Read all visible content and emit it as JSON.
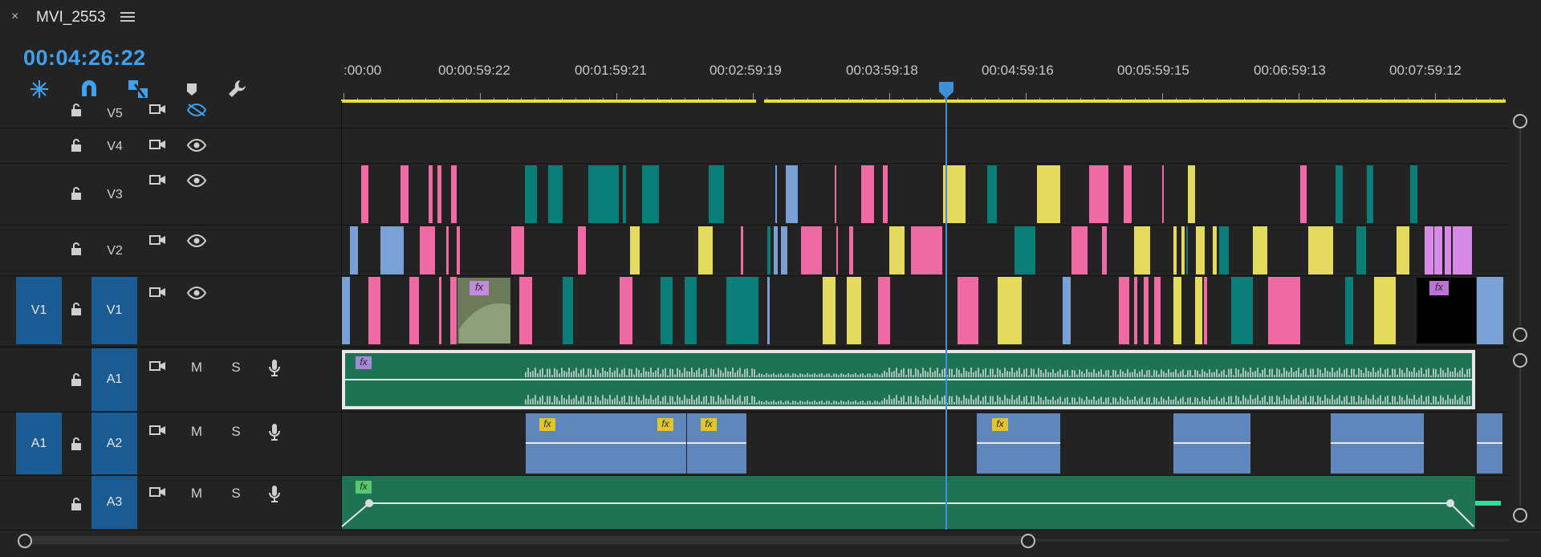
{
  "tab": {
    "close_glyph": "×",
    "title": "MVI_2553",
    "menu_icon": "hamburger-menu-icon"
  },
  "timecode": "00:04:26:22",
  "toolbar": {
    "icons": [
      "snap-icon",
      "magnet-icon",
      "linked-selection-icon",
      "add-marker-icon",
      "wrench-icon"
    ],
    "active_color": "#3ea0ef"
  },
  "ruler": {
    "labels": [
      ":00:00",
      "00:00:59:22",
      "00:01:59:21",
      "00:02:59:19",
      "00:03:59:18",
      "00:04:59:16",
      "00:05:59:15",
      "00:06:59:13",
      "00:07:59:12"
    ],
    "work_area_color": "#e8df3c"
  },
  "tracks": {
    "video": [
      {
        "name": "V5",
        "icon_eye": "eye-hidden-icon"
      },
      {
        "name": "V4",
        "icon_eye": "eye-icon"
      },
      {
        "name": "V3",
        "icon_eye": "eye-icon"
      },
      {
        "name": "V2",
        "icon_eye": "eye-icon"
      },
      {
        "name": "V1",
        "source": "V1",
        "icon_eye": "eye-icon"
      }
    ],
    "audio": [
      {
        "name": "A1",
        "mute": "M",
        "solo": "S"
      },
      {
        "name": "A2",
        "source": "A1",
        "mute": "M",
        "solo": "S"
      },
      {
        "name": "A3",
        "mute": "M",
        "solo": "S"
      }
    ]
  },
  "colors": {
    "pink": "#f06aa4",
    "teal": "#0b7e7a",
    "yellow": "#e3da5e",
    "blue": "#79a1d6",
    "violet": "#d78ae6",
    "audio_green": "#1e7455",
    "audio_blue": "#5f87bc",
    "track_source": "#1a5b94"
  },
  "fx_badge": "fx"
}
